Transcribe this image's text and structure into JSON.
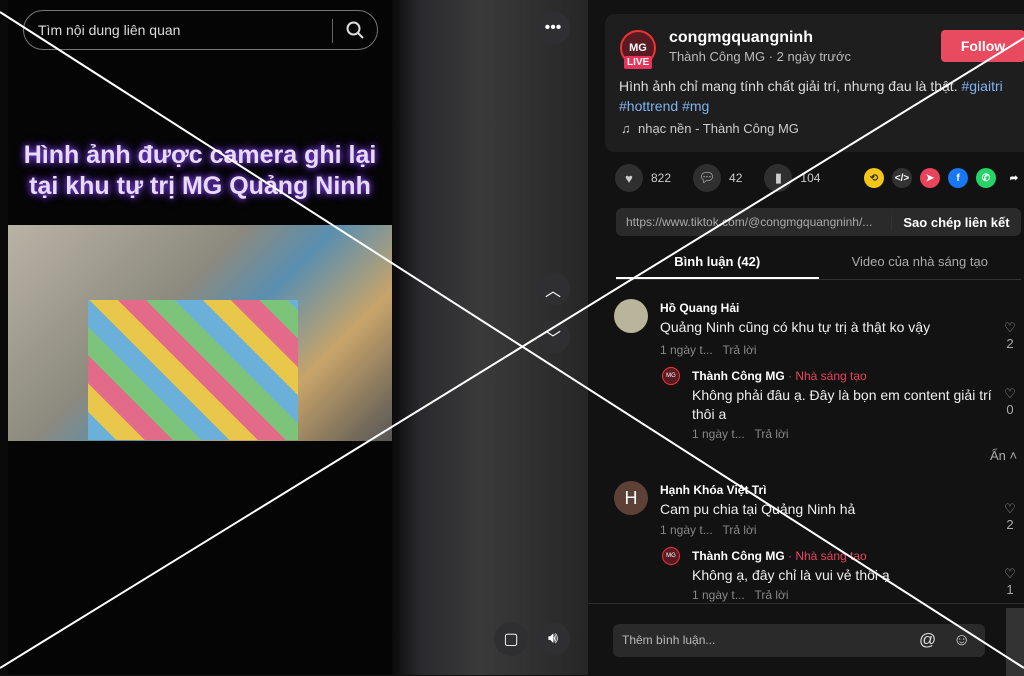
{
  "video": {
    "search_placeholder": "Tìm nội dung liên quan",
    "caption_line1": "Hình ảnh được camera ghi lại",
    "caption_line2": "tại khu tự trị MG Quảng Ninh"
  },
  "post": {
    "username": "congmgquangninh",
    "live_badge": "LIVE",
    "avatar_text": "MG",
    "display_name": "Thành Công MG",
    "time": "2 ngày trước",
    "follow_label": "Follow",
    "description": "Hình ảnh chỉ mang tính chất giải trí, nhưng đau là thật.",
    "hashtags": [
      "#giaitri",
      "#hottrend",
      "#mg"
    ],
    "music": "nhạc nền - Thành Công MG"
  },
  "stats": {
    "likes": "822",
    "comments": "42",
    "saves": "104"
  },
  "share_link": {
    "url": "https://www.tiktok.com/@congmgquangninh/...",
    "copy_label": "Sao chép liên kết"
  },
  "tabs": [
    {
      "label": "Bình luận (42)",
      "active": true
    },
    {
      "label": "Video của nhà sáng tạo",
      "active": false
    }
  ],
  "comments": [
    {
      "author": "Hồ Quang Hải",
      "text": "Quảng Ninh cũng có khu tự trị à thật ko vậy",
      "time": "1 ngày t...",
      "reply": "Trả lời",
      "likes": "2"
    },
    {
      "author": "Thành Công MG",
      "creator_tag": "· Nhà sáng tạo",
      "text": "Không phải đâu ạ. Đây là bọn em content giải trí thôi a",
      "time": "1 ngày t...",
      "reply": "Trả lời",
      "likes": "0"
    },
    {
      "author": "Hạnh Khóa Việt Trì",
      "avatar_letter": "H",
      "text": "Cam pu chia tại Quảng Ninh hả",
      "time": "1 ngày t...",
      "reply": "Trả lời",
      "likes": "2"
    },
    {
      "author": "Thành Công MG",
      "creator_tag": "· Nhà sáng tạo",
      "text": "Không ạ, đây chỉ là vui vẻ thôi ạ",
      "time": "1 ngày t...",
      "reply": "Trả lời",
      "likes": "1"
    }
  ],
  "hide_label": "Ẩn",
  "comment_input": {
    "placeholder": "Thêm bình luận..."
  },
  "colors": {
    "accent": "#e84a5f",
    "hashtag": "#7fb2f0",
    "background": "#121212"
  }
}
